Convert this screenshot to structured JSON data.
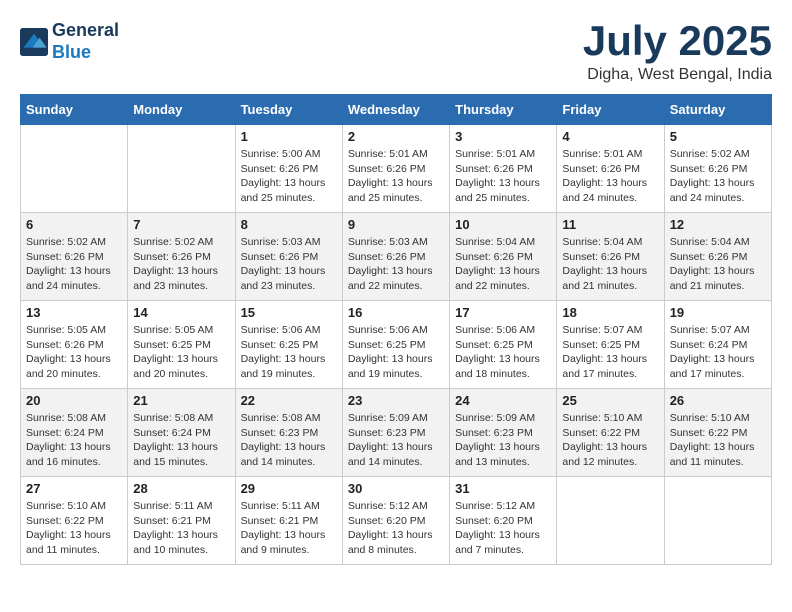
{
  "header": {
    "logo_line1": "General",
    "logo_line2": "Blue",
    "month_year": "July 2025",
    "location": "Digha, West Bengal, India"
  },
  "columns": [
    "Sunday",
    "Monday",
    "Tuesday",
    "Wednesday",
    "Thursday",
    "Friday",
    "Saturday"
  ],
  "weeks": [
    [
      {
        "day": "",
        "empty": true
      },
      {
        "day": "",
        "empty": true
      },
      {
        "day": "1",
        "sunrise": "Sunrise: 5:00 AM",
        "sunset": "Sunset: 6:26 PM",
        "daylight": "Daylight: 13 hours and 25 minutes."
      },
      {
        "day": "2",
        "sunrise": "Sunrise: 5:01 AM",
        "sunset": "Sunset: 6:26 PM",
        "daylight": "Daylight: 13 hours and 25 minutes."
      },
      {
        "day": "3",
        "sunrise": "Sunrise: 5:01 AM",
        "sunset": "Sunset: 6:26 PM",
        "daylight": "Daylight: 13 hours and 25 minutes."
      },
      {
        "day": "4",
        "sunrise": "Sunrise: 5:01 AM",
        "sunset": "Sunset: 6:26 PM",
        "daylight": "Daylight: 13 hours and 24 minutes."
      },
      {
        "day": "5",
        "sunrise": "Sunrise: 5:02 AM",
        "sunset": "Sunset: 6:26 PM",
        "daylight": "Daylight: 13 hours and 24 minutes."
      }
    ],
    [
      {
        "day": "6",
        "sunrise": "Sunrise: 5:02 AM",
        "sunset": "Sunset: 6:26 PM",
        "daylight": "Daylight: 13 hours and 24 minutes."
      },
      {
        "day": "7",
        "sunrise": "Sunrise: 5:02 AM",
        "sunset": "Sunset: 6:26 PM",
        "daylight": "Daylight: 13 hours and 23 minutes."
      },
      {
        "day": "8",
        "sunrise": "Sunrise: 5:03 AM",
        "sunset": "Sunset: 6:26 PM",
        "daylight": "Daylight: 13 hours and 23 minutes."
      },
      {
        "day": "9",
        "sunrise": "Sunrise: 5:03 AM",
        "sunset": "Sunset: 6:26 PM",
        "daylight": "Daylight: 13 hours and 22 minutes."
      },
      {
        "day": "10",
        "sunrise": "Sunrise: 5:04 AM",
        "sunset": "Sunset: 6:26 PM",
        "daylight": "Daylight: 13 hours and 22 minutes."
      },
      {
        "day": "11",
        "sunrise": "Sunrise: 5:04 AM",
        "sunset": "Sunset: 6:26 PM",
        "daylight": "Daylight: 13 hours and 21 minutes."
      },
      {
        "day": "12",
        "sunrise": "Sunrise: 5:04 AM",
        "sunset": "Sunset: 6:26 PM",
        "daylight": "Daylight: 13 hours and 21 minutes."
      }
    ],
    [
      {
        "day": "13",
        "sunrise": "Sunrise: 5:05 AM",
        "sunset": "Sunset: 6:26 PM",
        "daylight": "Daylight: 13 hours and 20 minutes."
      },
      {
        "day": "14",
        "sunrise": "Sunrise: 5:05 AM",
        "sunset": "Sunset: 6:25 PM",
        "daylight": "Daylight: 13 hours and 20 minutes."
      },
      {
        "day": "15",
        "sunrise": "Sunrise: 5:06 AM",
        "sunset": "Sunset: 6:25 PM",
        "daylight": "Daylight: 13 hours and 19 minutes."
      },
      {
        "day": "16",
        "sunrise": "Sunrise: 5:06 AM",
        "sunset": "Sunset: 6:25 PM",
        "daylight": "Daylight: 13 hours and 19 minutes."
      },
      {
        "day": "17",
        "sunrise": "Sunrise: 5:06 AM",
        "sunset": "Sunset: 6:25 PM",
        "daylight": "Daylight: 13 hours and 18 minutes."
      },
      {
        "day": "18",
        "sunrise": "Sunrise: 5:07 AM",
        "sunset": "Sunset: 6:25 PM",
        "daylight": "Daylight: 13 hours and 17 minutes."
      },
      {
        "day": "19",
        "sunrise": "Sunrise: 5:07 AM",
        "sunset": "Sunset: 6:24 PM",
        "daylight": "Daylight: 13 hours and 17 minutes."
      }
    ],
    [
      {
        "day": "20",
        "sunrise": "Sunrise: 5:08 AM",
        "sunset": "Sunset: 6:24 PM",
        "daylight": "Daylight: 13 hours and 16 minutes."
      },
      {
        "day": "21",
        "sunrise": "Sunrise: 5:08 AM",
        "sunset": "Sunset: 6:24 PM",
        "daylight": "Daylight: 13 hours and 15 minutes."
      },
      {
        "day": "22",
        "sunrise": "Sunrise: 5:08 AM",
        "sunset": "Sunset: 6:23 PM",
        "daylight": "Daylight: 13 hours and 14 minutes."
      },
      {
        "day": "23",
        "sunrise": "Sunrise: 5:09 AM",
        "sunset": "Sunset: 6:23 PM",
        "daylight": "Daylight: 13 hours and 14 minutes."
      },
      {
        "day": "24",
        "sunrise": "Sunrise: 5:09 AM",
        "sunset": "Sunset: 6:23 PM",
        "daylight": "Daylight: 13 hours and 13 minutes."
      },
      {
        "day": "25",
        "sunrise": "Sunrise: 5:10 AM",
        "sunset": "Sunset: 6:22 PM",
        "daylight": "Daylight: 13 hours and 12 minutes."
      },
      {
        "day": "26",
        "sunrise": "Sunrise: 5:10 AM",
        "sunset": "Sunset: 6:22 PM",
        "daylight": "Daylight: 13 hours and 11 minutes."
      }
    ],
    [
      {
        "day": "27",
        "sunrise": "Sunrise: 5:10 AM",
        "sunset": "Sunset: 6:22 PM",
        "daylight": "Daylight: 13 hours and 11 minutes."
      },
      {
        "day": "28",
        "sunrise": "Sunrise: 5:11 AM",
        "sunset": "Sunset: 6:21 PM",
        "daylight": "Daylight: 13 hours and 10 minutes."
      },
      {
        "day": "29",
        "sunrise": "Sunrise: 5:11 AM",
        "sunset": "Sunset: 6:21 PM",
        "daylight": "Daylight: 13 hours and 9 minutes."
      },
      {
        "day": "30",
        "sunrise": "Sunrise: 5:12 AM",
        "sunset": "Sunset: 6:20 PM",
        "daylight": "Daylight: 13 hours and 8 minutes."
      },
      {
        "day": "31",
        "sunrise": "Sunrise: 5:12 AM",
        "sunset": "Sunset: 6:20 PM",
        "daylight": "Daylight: 13 hours and 7 minutes."
      },
      {
        "day": "",
        "empty": true
      },
      {
        "day": "",
        "empty": true
      }
    ]
  ]
}
